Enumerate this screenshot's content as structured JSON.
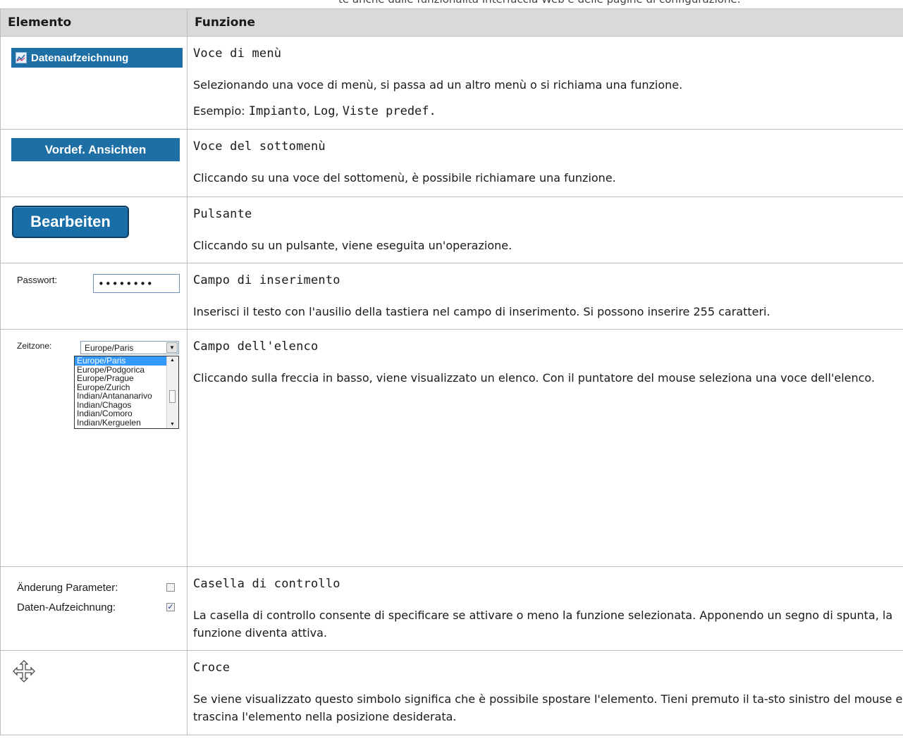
{
  "top_clip_text": "te anche dalle funzionalità Interfaccia Web e delle pagine di configurazione.",
  "header": {
    "col1": "Elemento",
    "col2": "Funzione"
  },
  "rows": [
    {
      "name": "menu-item",
      "elem": {
        "label": "Datenaufzeichnung",
        "icon": "chart-icon"
      },
      "title": "Voce di menù",
      "paragraphs": [
        "Selezionando una voce di menù, si passa ad un altro menù o si richiama una funzione."
      ],
      "example_prefix": "Esempio: ",
      "example_items": [
        "Impianto",
        "Log",
        "Viste predef."
      ],
      "example_separator": ", "
    },
    {
      "name": "submenu-item",
      "elem": {
        "label": "Vordef. Ansichten"
      },
      "title": "Voce del sottomenù",
      "paragraphs": [
        "Cliccando su una voce del sottomenù, è possibile richiamare una funzione."
      ]
    },
    {
      "name": "button",
      "elem": {
        "label": "Bearbeiten"
      },
      "title": "Pulsante",
      "paragraphs": [
        "Cliccando su un pulsante, viene eseguita un'operazione."
      ]
    },
    {
      "name": "input-field",
      "elem": {
        "label": "Passwort:",
        "value": "••••••••"
      },
      "title": "Campo di inserimento",
      "paragraphs": [
        "Inserisci il testo con l'ausilio della tastiera nel campo di inserimento. Si possono inserire 255 caratteri."
      ]
    },
    {
      "name": "list-field",
      "elem": {
        "label": "Zeitzone:",
        "selected": "Europe/Paris",
        "options": [
          "Europe/Paris",
          "Europe/Podgorica",
          "Europe/Prague",
          "Europe/Zurich",
          "Indian/Antananarivo",
          "Indian/Chagos",
          "Indian/Comoro",
          "Indian/Kerguelen"
        ]
      },
      "title": "Campo dell'elenco",
      "paragraphs": [
        "Cliccando sulla freccia in basso, viene visualizzato un elenco. Con il puntatore del mouse seleziona una voce dell'elenco."
      ]
    },
    {
      "name": "checkbox",
      "elem": {
        "items": [
          {
            "label": "Änderung Parameter:",
            "checked": false
          },
          {
            "label": "Daten-Aufzeichnung:",
            "checked": true
          }
        ]
      },
      "title": "Casella di controllo",
      "paragraphs": [
        "La casella di controllo consente di specificare se attivare o meno la funzione selezionata. Apponendo un segno di spunta, la funzione diventa attiva."
      ]
    },
    {
      "name": "cross",
      "elem": {
        "icon": "move-cross-icon"
      },
      "title": "Croce",
      "paragraphs": [
        "Se viene visualizzato questo simbolo significa che è possibile spostare l'elemento. Tieni premuto il ta-sto sinistro del mouse e trascina l'elemento nella posizione desiderata."
      ]
    }
  ]
}
